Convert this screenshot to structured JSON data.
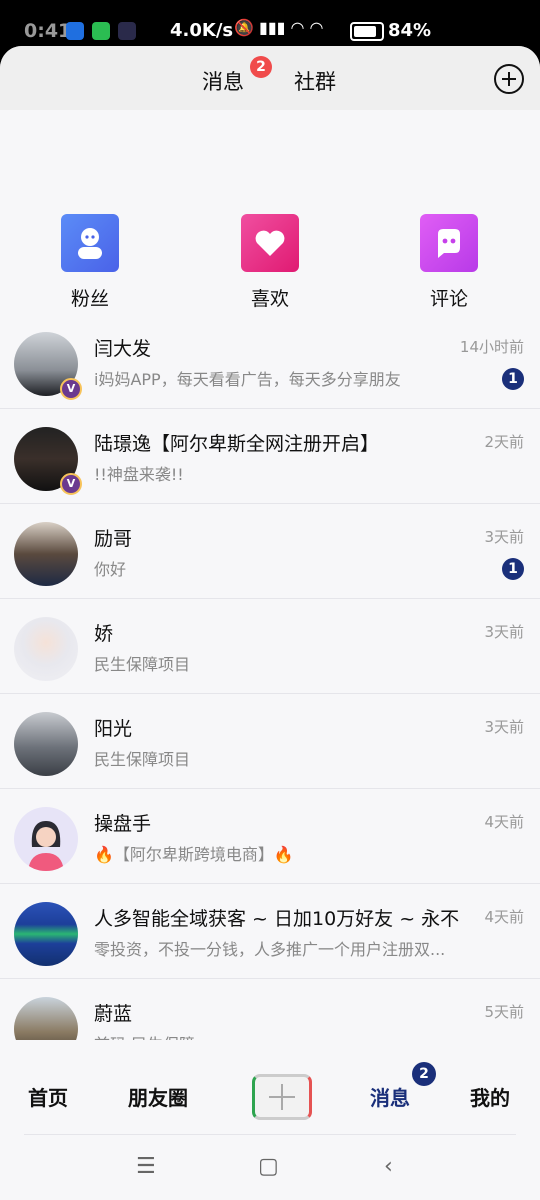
{
  "status_bar": {
    "time": "0:41",
    "network_speed": "4.0K/s",
    "battery": "84%"
  },
  "header": {
    "tabs": [
      {
        "label": "消息",
        "badge": "2"
      },
      {
        "label": "社群"
      }
    ]
  },
  "quick_actions": [
    {
      "label": "粉丝",
      "icon": "person-icon",
      "color": "#4f7bf3"
    },
    {
      "label": "喜欢",
      "icon": "heart-icon",
      "color": "#ef2e8a"
    },
    {
      "label": "评论",
      "icon": "chat-icon",
      "color": "#d24bf0"
    }
  ],
  "conversations": [
    {
      "name": "闫大发",
      "preview": "i妈妈APP，每天看看广告，每天多分享朋友",
      "time": "14小时前",
      "unread": "1"
    },
    {
      "name": "陆璟逸【阿尔卑斯全网注册开启】",
      "preview": "!!神盘来袭!!",
      "time": "2天前",
      "unread": ""
    },
    {
      "name": "励哥",
      "preview": "你好",
      "time": "3天前",
      "unread": "1"
    },
    {
      "name": "娇",
      "preview": " 民生保障项目",
      "time": "3天前",
      "unread": ""
    },
    {
      "name": "阳光",
      "preview": " 民生保障项目",
      "time": "3天前",
      "unread": ""
    },
    {
      "name": "操盘手",
      "preview": "🔥【阿尔卑斯跨境电商】🔥",
      "time": "4天前",
      "unread": ""
    },
    {
      "name": "人多智能全域获客 ~ 日加10万好友 ~ 永不",
      "preview": "零投资，不投一分钱，人多推广一个用户注册双...",
      "time": "4天前",
      "unread": ""
    },
    {
      "name": "蔚蓝",
      "preview": "首码 民生保障",
      "time": "5天前",
      "unread": ""
    }
  ],
  "bottom_nav": {
    "items": [
      "首页",
      "朋友圈",
      "消息",
      "我的"
    ],
    "message_badge": "2"
  }
}
